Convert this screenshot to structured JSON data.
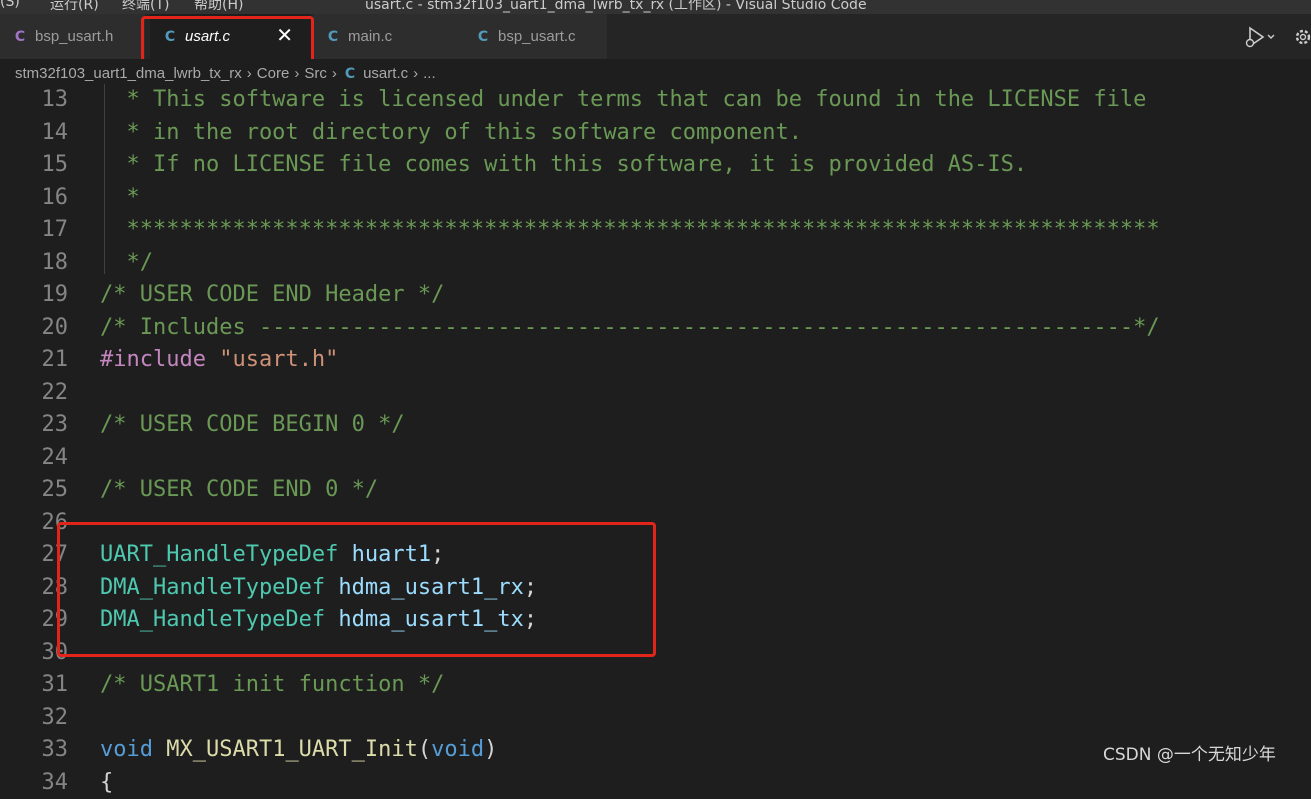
{
  "menubar": {
    "items": [
      "(S)",
      "运行(R)",
      "终端(T)",
      "帮助(H)"
    ],
    "window_title": "usart.c - stm32f103_uart1_dma_lwrb_tx_rx (工作区) - Visual Studio Code"
  },
  "tabs": [
    {
      "icon": "C",
      "icon_color": "#a074c4",
      "label": "bsp_usart.h",
      "active": false
    },
    {
      "icon": "C",
      "icon_color": "#519aba",
      "label": "usart.c",
      "active": true,
      "close": "✕"
    },
    {
      "icon": "C",
      "icon_color": "#519aba",
      "label": "main.c",
      "active": false
    },
    {
      "icon": "C",
      "icon_color": "#519aba",
      "label": "bsp_usart.c",
      "active": false
    }
  ],
  "toolbar": {
    "run_icon": "run-debug-icon",
    "gear_icon": "gear-icon"
  },
  "breadcrumb": {
    "items": [
      "stm32f103_uart1_dma_lwrb_tx_rx",
      "Core",
      "Src",
      "usart.c",
      "..."
    ],
    "file_icon": "C"
  },
  "editor": {
    "lines": [
      {
        "num": "13",
        "tokens": [
          {
            "c": "cmt",
            "t": "  * This software is licensed under terms that can be found in the LICENSE file"
          }
        ]
      },
      {
        "num": "14",
        "tokens": [
          {
            "c": "cmt",
            "t": "  * in the root directory of this software component."
          }
        ]
      },
      {
        "num": "15",
        "tokens": [
          {
            "c": "cmt",
            "t": "  * If no LICENSE file comes with this software, it is provided AS-IS."
          }
        ]
      },
      {
        "num": "16",
        "tokens": [
          {
            "c": "cmt",
            "t": "  *"
          }
        ]
      },
      {
        "num": "17",
        "tokens": [
          {
            "c": "cmt",
            "t": "  ******************************************************************************"
          }
        ]
      },
      {
        "num": "18",
        "tokens": [
          {
            "c": "cmt",
            "t": "  */"
          }
        ]
      },
      {
        "num": "19",
        "tokens": [
          {
            "c": "cmt",
            "t": "/* USER CODE END Header */"
          }
        ]
      },
      {
        "num": "20",
        "tokens": [
          {
            "c": "cmt",
            "t": "/* Includes ------------------------------------------------------------------*/"
          }
        ]
      },
      {
        "num": "21",
        "tokens": [
          {
            "c": "pre",
            "t": "#include "
          },
          {
            "c": "str",
            "t": "\"usart.h\""
          }
        ]
      },
      {
        "num": "22",
        "tokens": []
      },
      {
        "num": "23",
        "tokens": [
          {
            "c": "cmt",
            "t": "/* USER CODE BEGIN 0 */"
          }
        ]
      },
      {
        "num": "24",
        "tokens": []
      },
      {
        "num": "25",
        "tokens": [
          {
            "c": "cmt",
            "t": "/* USER CODE END 0 */"
          }
        ]
      },
      {
        "num": "26",
        "tokens": []
      },
      {
        "num": "27",
        "tokens": [
          {
            "c": "typ",
            "t": "UART_HandleTypeDef"
          },
          {
            "c": "pun",
            "t": " "
          },
          {
            "c": "var",
            "t": "huart1"
          },
          {
            "c": "pun",
            "t": ";"
          }
        ]
      },
      {
        "num": "28",
        "tokens": [
          {
            "c": "typ",
            "t": "DMA_HandleTypeDef"
          },
          {
            "c": "pun",
            "t": " "
          },
          {
            "c": "var",
            "t": "hdma_usart1_rx"
          },
          {
            "c": "pun",
            "t": ";"
          }
        ]
      },
      {
        "num": "29",
        "tokens": [
          {
            "c": "typ",
            "t": "DMA_HandleTypeDef"
          },
          {
            "c": "pun",
            "t": " "
          },
          {
            "c": "var",
            "t": "hdma_usart1_tx"
          },
          {
            "c": "pun",
            "t": ";"
          }
        ]
      },
      {
        "num": "30",
        "tokens": []
      },
      {
        "num": "31",
        "tokens": [
          {
            "c": "cmt",
            "t": "/* USART1 init function */"
          }
        ]
      },
      {
        "num": "32",
        "tokens": []
      },
      {
        "num": "33",
        "tokens": [
          {
            "c": "kw",
            "t": "void"
          },
          {
            "c": "pun",
            "t": " "
          },
          {
            "c": "fn",
            "t": "MX_USART1_UART_Init"
          },
          {
            "c": "pun",
            "t": "("
          },
          {
            "c": "kw",
            "t": "void"
          },
          {
            "c": "pun",
            "t": ")"
          }
        ]
      },
      {
        "num": "34",
        "tokens": [
          {
            "c": "pun",
            "t": "{"
          }
        ]
      }
    ]
  },
  "colors": {
    "highlight_border": "#e1251b",
    "comment": "#6a9955",
    "type": "#4ec9b0",
    "variable": "#9cdcfe",
    "keyword": "#569cd6"
  },
  "watermark": "CSDN @一个无知少年"
}
